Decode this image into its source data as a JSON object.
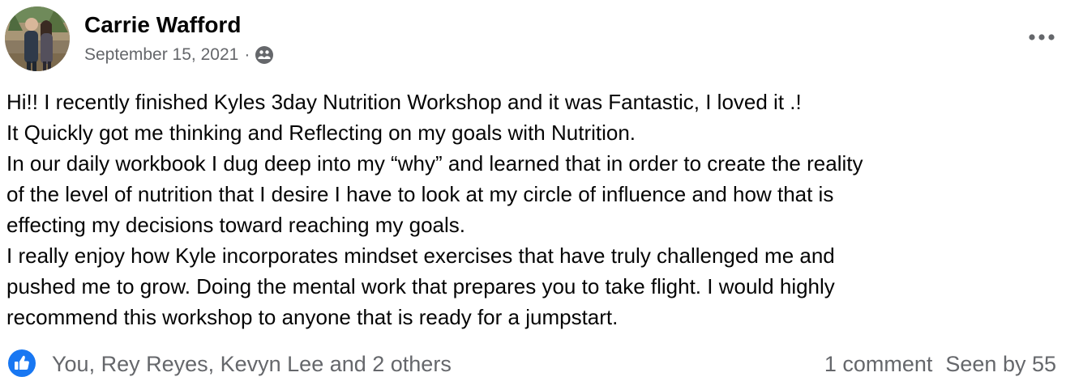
{
  "post": {
    "author_name": "Carrie Wafford",
    "date": "September 15, 2021",
    "separator": "·",
    "audience_icon": "friends-icon",
    "more_icon": "more-options-icon",
    "body_lines": [
      "Hi!! I recently finished Kyles 3day Nutrition Workshop and it was Fantastic, I loved it .!",
      "It Quickly got me thinking and Reflecting on my goals with Nutrition.",
      "In our daily workbook I dug deep into my “why” and learned that in order to create the reality",
      "of the level of nutrition that I desire I have to look at my circle of influence and how that is",
      "effecting my decisions toward reaching my goals.",
      "I really enjoy how  Kyle incorporates mindset exercises that have truly challenged me and",
      "pushed me to grow. Doing the mental work that prepares you to take flight. I would highly",
      "recommend this workshop to anyone that is ready for a jumpstart."
    ]
  },
  "footer": {
    "like_icon": "like-icon",
    "reactors": "You, Rey Reyes, Kevyn Lee and 2 others",
    "comments": "1 comment",
    "seen_by": "Seen by 55"
  },
  "colors": {
    "text_primary": "#050505",
    "text_secondary": "#65676b",
    "like_blue": "#1877f2"
  }
}
